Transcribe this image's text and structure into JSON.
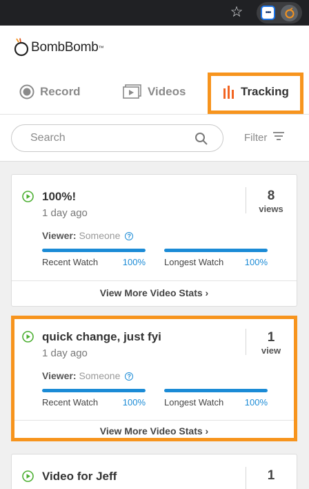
{
  "browser": {
    "star_icon": "star-icon",
    "extension_icons": [
      "ellipsis-extension-icon",
      "bombbomb-extension-icon"
    ]
  },
  "brand": {
    "logo_text": "BombBomb",
    "trademark": "™",
    "accent_color": "#f7941d"
  },
  "tabs": [
    {
      "label": "Record",
      "icon": "record-icon",
      "active": false
    },
    {
      "label": "Videos",
      "icon": "video-icon",
      "active": false
    },
    {
      "label": "Tracking",
      "icon": "bar-chart-icon",
      "active": true
    }
  ],
  "search": {
    "placeholder": "Search",
    "value": "",
    "filter_label": "Filter"
  },
  "cards": [
    {
      "title": "100%!",
      "date": "1 day ago",
      "count": "8",
      "count_unit": "views",
      "viewer_label": "Viewer:",
      "viewer_name": "Someone",
      "recent_watch_label": "Recent Watch",
      "recent_watch_pct": "100%",
      "recent_watch_value": 1.0,
      "longest_watch_label": "Longest Watch",
      "longest_watch_pct": "100%",
      "longest_watch_value": 1.0,
      "footer": "View More Video Stats ›"
    },
    {
      "title": "quick change, just fyi",
      "date": "1 day ago",
      "count": "1",
      "count_unit": "view",
      "viewer_label": "Viewer:",
      "viewer_name": "Someone",
      "recent_watch_label": "Recent Watch",
      "recent_watch_pct": "100%",
      "recent_watch_value": 1.0,
      "longest_watch_label": "Longest Watch",
      "longest_watch_pct": "100%",
      "longest_watch_value": 1.0,
      "footer": "View More Video Stats ›"
    },
    {
      "title": "Video for Jeff",
      "count": "1"
    }
  ],
  "colors": {
    "progress": "#1b8bd6",
    "play_icon": "#4caf32",
    "highlight": "#f7941d"
  }
}
